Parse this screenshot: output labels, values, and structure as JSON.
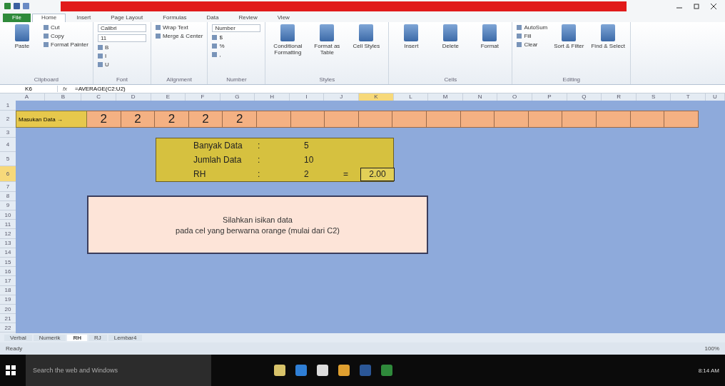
{
  "ribbon_tabs": [
    {
      "label": "File",
      "selected": false,
      "kind": "file"
    },
    {
      "label": "Home",
      "selected": true,
      "kind": "tab"
    },
    {
      "label": "Insert",
      "selected": false,
      "kind": "tab"
    },
    {
      "label": "Page Layout",
      "selected": false,
      "kind": "tab"
    },
    {
      "label": "Formulas",
      "selected": false,
      "kind": "tab"
    },
    {
      "label": "Data",
      "selected": false,
      "kind": "tab"
    },
    {
      "label": "Review",
      "selected": false,
      "kind": "tab"
    },
    {
      "label": "View",
      "selected": false,
      "kind": "tab"
    }
  ],
  "ribbon_groups": [
    {
      "title": "Clipboard",
      "big": [
        "Paste"
      ],
      "small": [
        "Cut",
        "Copy",
        "Format Painter"
      ]
    },
    {
      "title": "Font",
      "fields": [
        "Calibri",
        "11"
      ],
      "small": [
        "B",
        "I",
        "U"
      ]
    },
    {
      "title": "Alignment",
      "small": [
        "Wrap Text",
        "Merge & Center"
      ]
    },
    {
      "title": "Number",
      "fields": [
        "Number"
      ],
      "small": [
        "$",
        "%",
        ","
      ]
    },
    {
      "title": "Styles",
      "big": [
        "Conditional Formatting",
        "Format as Table",
        "Cell Styles"
      ]
    },
    {
      "title": "Cells",
      "big": [
        "Insert",
        "Delete",
        "Format"
      ]
    },
    {
      "title": "Editing",
      "small": [
        "AutoSum",
        "Fill",
        "Clear"
      ],
      "big": [
        "Sort & Filter",
        "Find & Select"
      ]
    }
  ],
  "formula_bar": {
    "name_box": "K6",
    "fx": "fx",
    "formula": "=AVERAGE(C2:U2)"
  },
  "columns": [
    {
      "label": "A",
      "selected": false
    },
    {
      "label": "B",
      "selected": false
    },
    {
      "label": "C",
      "selected": false
    },
    {
      "label": "D",
      "selected": false
    },
    {
      "label": "E",
      "selected": false
    },
    {
      "label": "F",
      "selected": false
    },
    {
      "label": "G",
      "selected": false
    },
    {
      "label": "H",
      "selected": false
    },
    {
      "label": "I",
      "selected": false
    },
    {
      "label": "J",
      "selected": false
    },
    {
      "label": "K",
      "selected": true
    },
    {
      "label": "L",
      "selected": false
    },
    {
      "label": "M",
      "selected": false
    },
    {
      "label": "N",
      "selected": false
    },
    {
      "label": "O",
      "selected": false
    },
    {
      "label": "P",
      "selected": false
    },
    {
      "label": "Q",
      "selected": false
    },
    {
      "label": "R",
      "selected": false
    },
    {
      "label": "S",
      "selected": false
    },
    {
      "label": "T",
      "selected": false
    },
    {
      "label": "U",
      "selected": false
    }
  ],
  "rows": [
    {
      "label": "1",
      "selected": false
    },
    {
      "label": "2",
      "selected": false
    },
    {
      "label": "3",
      "selected": false
    },
    {
      "label": "4",
      "selected": false
    },
    {
      "label": "5",
      "selected": false
    },
    {
      "label": "6",
      "selected": true
    },
    {
      "label": "7",
      "selected": false
    },
    {
      "label": "8",
      "selected": false
    },
    {
      "label": "9",
      "selected": false
    },
    {
      "label": "10",
      "selected": false
    },
    {
      "label": "11",
      "selected": false
    },
    {
      "label": "12",
      "selected": false
    },
    {
      "label": "13",
      "selected": false
    },
    {
      "label": "14",
      "selected": false
    },
    {
      "label": "15",
      "selected": false
    },
    {
      "label": "16",
      "selected": false
    },
    {
      "label": "17",
      "selected": false
    },
    {
      "label": "18",
      "selected": false
    },
    {
      "label": "19",
      "selected": false
    },
    {
      "label": "20",
      "selected": false
    },
    {
      "label": "21",
      "selected": false
    },
    {
      "label": "22",
      "selected": false
    }
  ],
  "input_row": {
    "label": "Masukan Data →",
    "values": [
      "2",
      "2",
      "2",
      "2",
      "2"
    ]
  },
  "summary": [
    {
      "label": "Banyak Data",
      "sep": ":",
      "value": "5"
    },
    {
      "label": "Jumlah Data",
      "sep": ":",
      "value": "10"
    },
    {
      "label": "RH",
      "sep": ":",
      "value": "2",
      "eq": "=",
      "result": "2.00"
    }
  ],
  "note": [
    "Silahkan isikan data",
    "pada cel yang berwarna orange (mulai dari C2)"
  ],
  "sheet_tabs": [
    {
      "label": "Verbal",
      "selected": false
    },
    {
      "label": "Numerik",
      "selected": false
    },
    {
      "label": "RH",
      "selected": true
    },
    {
      "label": "RJ",
      "selected": false
    },
    {
      "label": "Lembar4",
      "selected": false
    }
  ],
  "status": {
    "text": "Ready",
    "zoom": "100%"
  },
  "taskbar": {
    "search": "Search the web and Windows",
    "time": "8:14 AM"
  }
}
